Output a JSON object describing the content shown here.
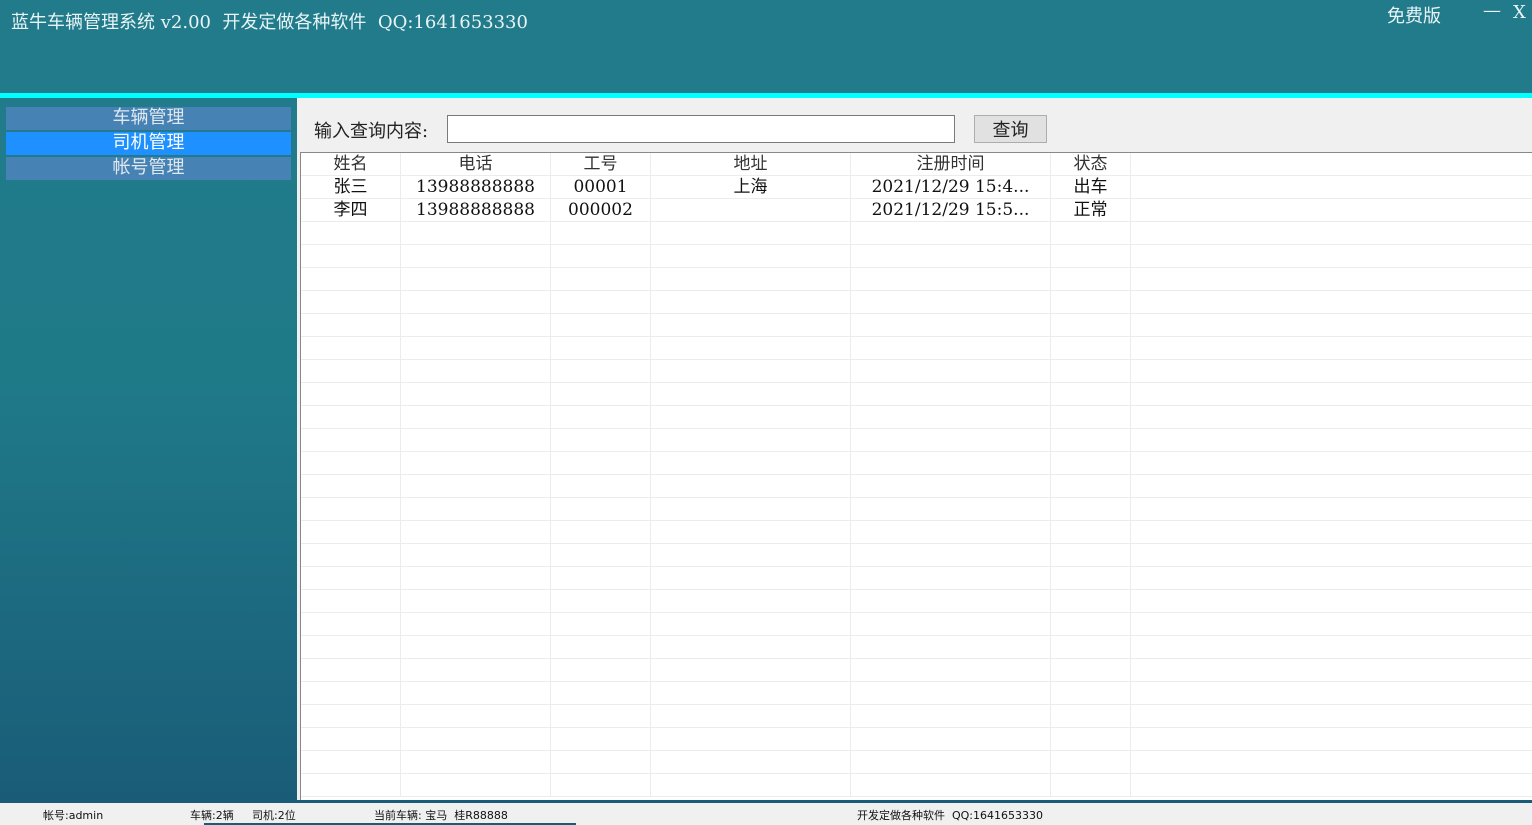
{
  "titlebar": {
    "title": "蓝牛车辆管理系统 v2.00  开发定做各种软件  QQ:1641653330",
    "edition": "免费版",
    "minimize": "—",
    "close": "X"
  },
  "sidebar": {
    "items": [
      {
        "label": "车辆管理"
      },
      {
        "label": "司机管理",
        "active": true
      },
      {
        "label": "帐号管理"
      }
    ]
  },
  "search": {
    "label": "输入查询内容:",
    "value": "",
    "button": "查询"
  },
  "table": {
    "columns": [
      "姓名",
      "电话",
      "工号",
      "地址",
      "注册时间",
      "状态"
    ],
    "rows": [
      [
        "张三",
        "13988888888",
        "00001",
        "上海",
        "2021/12/29 15:4...",
        "出车"
      ],
      [
        "李四",
        "13988888888",
        "000002",
        "",
        "2021/12/29 15:5...",
        "正常"
      ]
    ]
  },
  "status": {
    "account": "帐号:admin",
    "vehicles": "车辆:2辆",
    "drivers": "司机:2位",
    "current": "当前车辆: 宝马  桂R88888",
    "footer": "开发定做各种软件  QQ:1641653330"
  },
  "colors": {
    "header": "#217b8a",
    "accent": "#00ffff",
    "nav": "#4682b4",
    "nav_active": "#1e90ff"
  }
}
